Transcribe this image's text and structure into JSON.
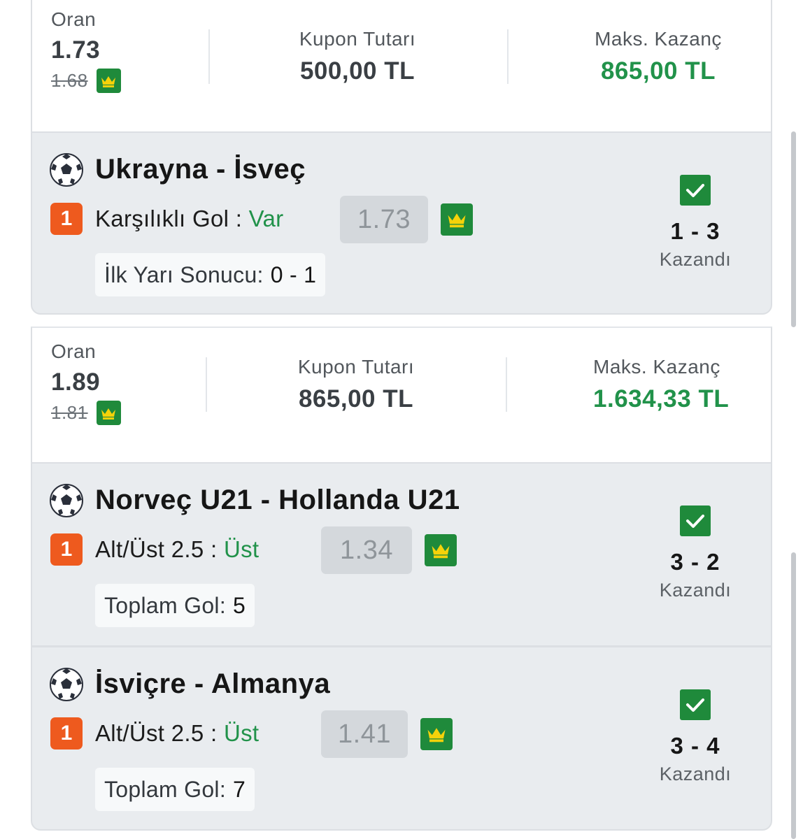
{
  "labels": {
    "odds": "Oran",
    "stake": "Kupon Tutarı",
    "max_win": "Maks. Kazanç",
    "won": "Kazandı"
  },
  "coupons": [
    {
      "odds": "1.73",
      "old_odds": "1.68",
      "stake": "500,00 TL",
      "max_win": "865,00 TL"
    },
    {
      "odds": "1.89",
      "old_odds": "1.81",
      "stake": "865,00 TL",
      "max_win": "1.634,33 TL"
    }
  ],
  "matches": [
    {
      "title": "Ukrayna - İsveç",
      "badge": "1",
      "market": "Karşılıklı Gol :",
      "pick": "Var",
      "odds": "1.73",
      "info_label": "İlk Yarı Sonucu:",
      "info_value": "0 - 1",
      "score": "1 - 3"
    },
    {
      "title": "Norveç U21 - Hollanda U21",
      "badge": "1",
      "market": "Alt/Üst 2.5 :",
      "pick": "Üst",
      "odds": "1.34",
      "info_label": "Toplam Gol:",
      "info_value": "5",
      "score": "3 - 2"
    },
    {
      "title": "İsviçre - Almanya",
      "badge": "1",
      "market": "Alt/Üst 2.5 :",
      "pick": "Üst",
      "odds": "1.41",
      "info_label": "Toplam Gol:",
      "info_value": "7",
      "score": "3 - 4"
    }
  ],
  "icons": {
    "sport": "soccer-ball-icon",
    "boost": "crown-icon",
    "status": "checkmark-icon"
  },
  "colors": {
    "accent_green": "#21924a",
    "badge_orange": "#ee5a1e",
    "crown_green": "#1f8a3b",
    "card_bg": "#e9ecef"
  }
}
